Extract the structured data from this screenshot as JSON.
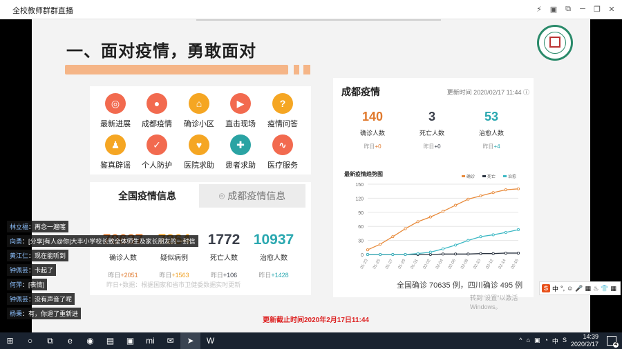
{
  "window": {
    "title": "全校教师群群直播"
  },
  "slide": {
    "heading": "一、面对疫情，勇敢面对",
    "icons": [
      {
        "label": "最新进展",
        "color": "#f26a4f",
        "glyph": "◎"
      },
      {
        "label": "成都疫情",
        "color": "#f26a4f",
        "glyph": "●"
      },
      {
        "label": "确诊小区",
        "color": "#f5a623",
        "glyph": "⌂"
      },
      {
        "label": "直击现场",
        "color": "#f26a4f",
        "glyph": "▶"
      },
      {
        "label": "疫情问答",
        "color": "#f5a623",
        "glyph": "?"
      },
      {
        "label": "鉴真辟谣",
        "color": "#f5a623",
        "glyph": "♟"
      },
      {
        "label": "个人防护",
        "color": "#f26a4f",
        "glyph": "✓"
      },
      {
        "label": "医院求助",
        "color": "#f5a623",
        "glyph": "♥"
      },
      {
        "label": "患者求助",
        "color": "#2aa3a3",
        "glyph": "✚"
      },
      {
        "label": "医疗服务",
        "color": "#f26a4f",
        "glyph": "∿"
      }
    ],
    "national": {
      "tab_active": "全国疫情信息",
      "tab_inactive": "成都疫情信息",
      "stats": [
        {
          "value": "70637",
          "label": "确诊人数",
          "delta_prefix": "昨日",
          "delta": "+2051",
          "color": "#e07a2e"
        },
        {
          "value": "7264",
          "label": "疑似病例",
          "delta_prefix": "昨日",
          "delta": "+1563",
          "color": "#f0a020"
        },
        {
          "value": "1772",
          "label": "死亡人数",
          "delta_prefix": "昨日",
          "delta": "+106",
          "color": "#3a3f4a"
        },
        {
          "value": "10937",
          "label": "治愈人数",
          "delta_prefix": "昨日",
          "delta": "+1428",
          "color": "#2aa8b0"
        }
      ],
      "footnote": "昨日+数据：根据国家和省市卫健委数据实时更新"
    },
    "chengdu": {
      "title": "成都疫情",
      "update_time": "更新时间 2020/02/17 11:44",
      "stats": [
        {
          "value": "140",
          "label": "确诊人数",
          "delta_prefix": "昨日",
          "delta": "+0",
          "color": "#e07a2e"
        },
        {
          "value": "3",
          "label": "死亡人数",
          "delta_prefix": "昨日",
          "delta": "+0",
          "color": "#3a3f4a"
        },
        {
          "value": "53",
          "label": "治愈人数",
          "delta_prefix": "昨日",
          "delta": "+4",
          "color": "#2aa8b0"
        }
      ]
    },
    "overlay_text": "全国确诊 70635 例，四川确诊 495 例",
    "overlay_windows": "转到\"设置\"以激活 Windows。",
    "cutoff": "更新截止时间2020年2月17日11:44"
  },
  "chart_data": {
    "type": "line",
    "title": "最新疫情趋势图",
    "legend": [
      "确诊",
      "死亡",
      "治愈"
    ],
    "legend_placement": "top-right",
    "x": [
      "01-23",
      "01-25",
      "01-27",
      "01-29",
      "01-31",
      "02-02",
      "02-04",
      "02-06",
      "02-08",
      "02-10",
      "02-12",
      "02-14",
      "02-16"
    ],
    "ylim": [
      0,
      150
    ],
    "yticks": [
      0,
      30,
      60,
      90,
      120,
      150
    ],
    "grid": true,
    "series": [
      {
        "name": "确诊",
        "color": "#e88a3a",
        "values": [
          10,
          22,
          38,
          55,
          70,
          80,
          92,
          105,
          118,
          125,
          132,
          138,
          140
        ]
      },
      {
        "name": "死亡",
        "color": "#2a3340",
        "values": [
          0,
          0,
          0,
          0,
          0,
          0,
          1,
          1,
          1,
          2,
          2,
          3,
          3
        ]
      },
      {
        "name": "治愈",
        "color": "#3cb8c4",
        "values": [
          0,
          0,
          0,
          0,
          2,
          5,
          12,
          20,
          30,
          38,
          42,
          47,
          53
        ]
      }
    ]
  },
  "chat": [
    {
      "name": "林立福",
      "msg": "再念一遍噻"
    },
    {
      "name": "向勇",
      "msg": "[分享]有人@你|大丰小学校长致全体师生及家长朋友的一封信"
    },
    {
      "name": "黄江仁",
      "msg": "现在能听到"
    },
    {
      "name": "钟佩芸",
      "msg": "卡起了"
    },
    {
      "name": "何萍",
      "msg": "[表情]"
    },
    {
      "name": "钟佩芸",
      "msg": "没有声音了呢"
    },
    {
      "name": "杨秉",
      "msg": "有，你退了重新进"
    }
  ],
  "ime": {
    "logo": "S",
    "mode": "中"
  },
  "taskbar": {
    "apps": [
      "⊞",
      "○",
      "⧉",
      "e",
      "◉",
      "▤",
      "▣",
      "mi",
      "✉",
      "➤",
      "W"
    ],
    "tray": [
      "^",
      "⌂",
      "▣",
      "◔",
      "中",
      "S"
    ],
    "time": "14:39",
    "date": "2020/2/17",
    "notifications": "4"
  }
}
